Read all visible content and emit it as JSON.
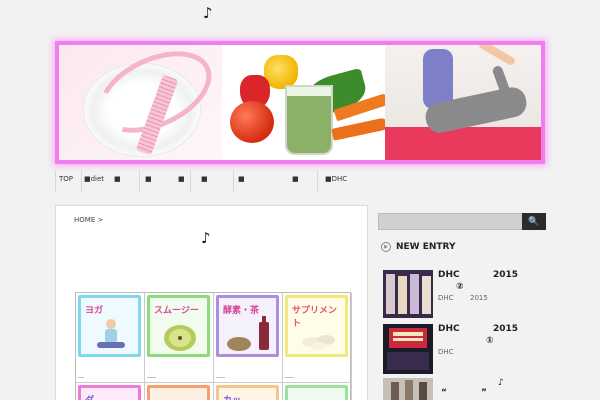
{
  "site": {
    "title": "♪"
  },
  "nav": {
    "items": [
      "TOP",
      "■diet",
      "■",
      "■",
      "■",
      "■",
      "■",
      "■DHC"
    ]
  },
  "breadcrumb": {
    "home": "HOME",
    "sep": ">"
  },
  "post": {
    "title": "♪"
  },
  "categories": [
    {
      "label": "ヨガ",
      "border": "#7fd8f0",
      "bg": "#eefafd",
      "color": "#d84a9a",
      "caption": "__"
    },
    {
      "label": "スムージー",
      "border": "#8ddc7a",
      "bg": "#f1fbee",
      "color": "#d84a9a",
      "caption": "___"
    },
    {
      "label": "酵素・茶",
      "border": "#a98fe0",
      "bg": "#f4f0fc",
      "color": "#d84a9a",
      "caption": "___"
    },
    {
      "label": "サプリメント",
      "border": "#f3e97a",
      "bg": "#fffde8",
      "color": "#e5546a",
      "caption": "___"
    },
    {
      "label": "ダ…",
      "border": "#f07ad8",
      "bg": "#fde9f8",
      "color": "#7a5ad8"
    },
    {
      "label": "",
      "border": "#f7a06a",
      "bg": "#fdefe3",
      "color": "#333"
    },
    {
      "label": "カッ…",
      "border": "#f5c58a",
      "bg": "#fff5e6",
      "color": "#7a5ad8"
    },
    {
      "label": "",
      "border": "#9ee0a0",
      "bg": "#eefbee",
      "color": "#333"
    }
  ],
  "sidebar": {
    "search_button": "🔍",
    "new_entry_title": "NEW ENTRY",
    "entries": [
      {
        "title_1": "DHC",
        "title_2": "2015",
        "title_3": "②",
        "meta_1": "DHC",
        "meta_2": "2015"
      },
      {
        "title_1": "DHC",
        "title_2": "2015",
        "title_3": "①",
        "meta_1": "DHC"
      },
      {
        "title_1": "“",
        "title_2": "”",
        "title_3": "♪"
      }
    ]
  },
  "colors": {
    "banner_border": "#f07ef0",
    "accent": "#2b2b2b"
  }
}
